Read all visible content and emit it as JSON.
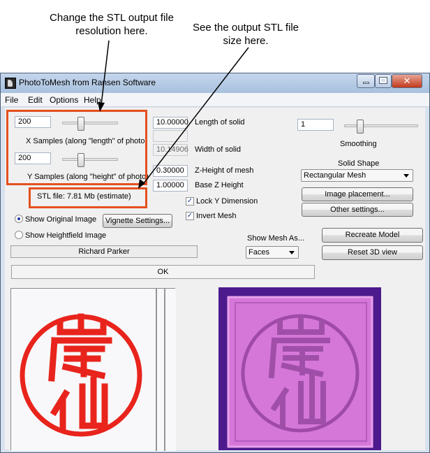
{
  "callouts": {
    "resolution": "Change the STL output file resolution here.",
    "filesize": "See the output STL file size here."
  },
  "window": {
    "title": "PhotoToMesh from Ransen Software",
    "close_glyph": "✕"
  },
  "menu": [
    "File",
    "Edit",
    "Options",
    "Help"
  ],
  "samples": {
    "x_value": "200",
    "x_label": "X Samples (along \"length\" of photo)",
    "x_slider_level": 0.3,
    "y_value": "200",
    "y_label": "Y Samples (along \"height\" of photo)",
    "y_slider_level": 0.3,
    "stl_file": "STL file: 7.81 Mb (estimate)"
  },
  "dimensions": {
    "length_value": "10.00000",
    "length_label": "Length of solid",
    "width_value": "10.14906",
    "width_label": "Width of solid",
    "zheight_value": "0.30000",
    "zheight_label": "Z-Height of mesh",
    "basez_value": "1.00000",
    "basez_label": "Base Z Height",
    "lock_y_label": "Lock Y Dimension",
    "lock_y_checked": true,
    "invert_label": "Invert Mesh",
    "invert_checked": true
  },
  "smoothing": {
    "value": "1",
    "label": "Smoothing",
    "slider_level": 0.05
  },
  "solid_shape": {
    "label": "Solid Shape",
    "selected": "Rectangular Mesh"
  },
  "buttons": {
    "image_placement": "Image placement...",
    "other_settings": "Other settings...",
    "vignette": "Vignette Settings...",
    "recreate": "Recreate Model",
    "reset_view": "Reset 3D view",
    "ok": "OK"
  },
  "view_mode": {
    "original": "Show Original Image",
    "heightfield": "Show Heightfield Image",
    "selected": "original"
  },
  "user_name": "Richard Parker",
  "mesh_view": {
    "label": "Show Mesh As...",
    "selected": "Faces"
  },
  "colors": {
    "callout_border": "#e5501e",
    "seal_red": "#e8241c",
    "mesh_bg": "#4c1a8c",
    "mesh_tile": "#d577d9"
  }
}
